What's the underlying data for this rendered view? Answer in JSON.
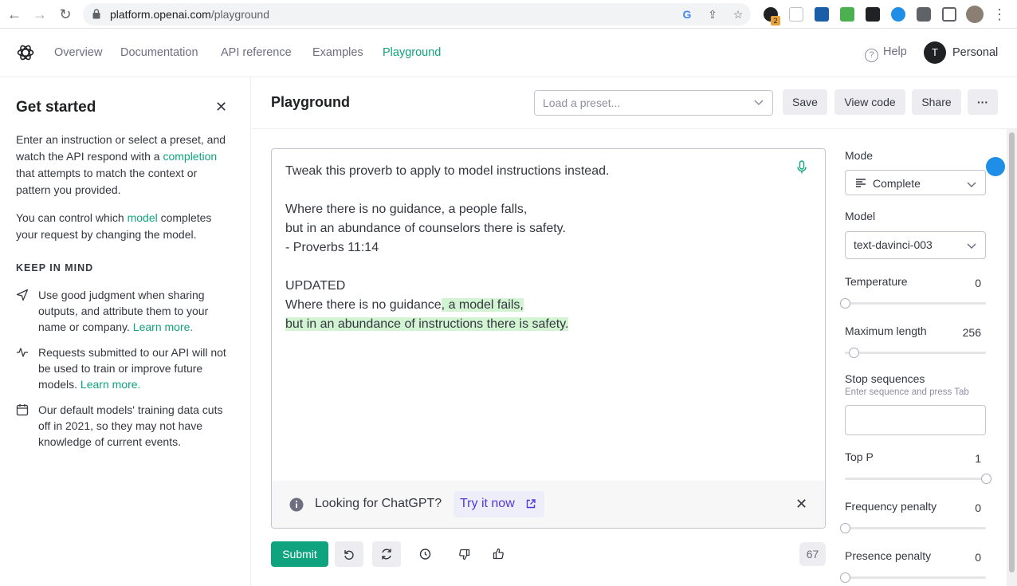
{
  "browser": {
    "url_host": "platform.openai.com",
    "url_path": "/playground",
    "extension_badge": "2"
  },
  "header": {
    "nav": [
      "Overview",
      "Documentation",
      "API reference",
      "Examples",
      "Playground"
    ],
    "help": "Help",
    "avatar_initial": "T",
    "account": "Personal"
  },
  "get_started": {
    "title": "Get started",
    "p1_pre": "Enter an instruction or select a preset, and watch the API respond with a",
    "p1_link": "completion",
    "p1_post": "that attempts to match the context or pattern you provided.",
    "p2_pre": "You can control which",
    "p2_link": "model",
    "p2_post": "completes your request by changing the model.",
    "keep_in_mind": "KEEP IN MIND",
    "tips": [
      {
        "text": "Use good judgment when sharing outputs, and attribute them to your name or company.",
        "link": "Learn more."
      },
      {
        "text": "Requests submitted to our API will not be used to train or improve future models.",
        "link": "Learn more."
      },
      {
        "text": "Our default models' training data cuts off in 2021, so they may not have knowledge of current events.",
        "link": ""
      }
    ]
  },
  "toolbar": {
    "title": "Playground",
    "preset_placeholder": "Load a preset...",
    "save": "Save",
    "view_code": "View code",
    "share": "Share",
    "more": "···"
  },
  "editor": {
    "prompt_lines": [
      "Tweak this proverb to apply to model instructions instead.",
      "",
      "Where there is no guidance, a people falls,",
      "but in an abundance of counselors there is safety.",
      "- Proverbs 11:14",
      "",
      "UPDATED",
      "Where there is no guidance"
    ],
    "completion_line1": ", a model fails,",
    "completion_line2": "but in an abundance of instructions there is safety."
  },
  "banner": {
    "text": "Looking for ChatGPT?",
    "cta": "Try it now"
  },
  "bottom": {
    "submit": "Submit",
    "token_count": "67"
  },
  "settings": {
    "mode_label": "Mode",
    "mode_value": "Complete",
    "model_label": "Model",
    "model_value": "text-davinci-003",
    "temperature_label": "Temperature",
    "temperature_value": "0",
    "temperature_fraction": 0.0,
    "max_length_label": "Maximum length",
    "max_length_value": "256",
    "max_length_fraction": 0.06,
    "stop_label": "Stop sequences",
    "stop_hint": "Enter sequence and press Tab",
    "top_p_label": "Top P",
    "top_p_value": "1",
    "top_p_fraction": 1.0,
    "freq_label": "Frequency penalty",
    "freq_value": "0",
    "freq_fraction": 0.0,
    "presence_label": "Presence penalty",
    "presence_value": "0",
    "presence_fraction": 0.0
  },
  "colors": {
    "accent": "#10a37f",
    "highlight": "#d2f4d3",
    "cta": "#5436da"
  }
}
